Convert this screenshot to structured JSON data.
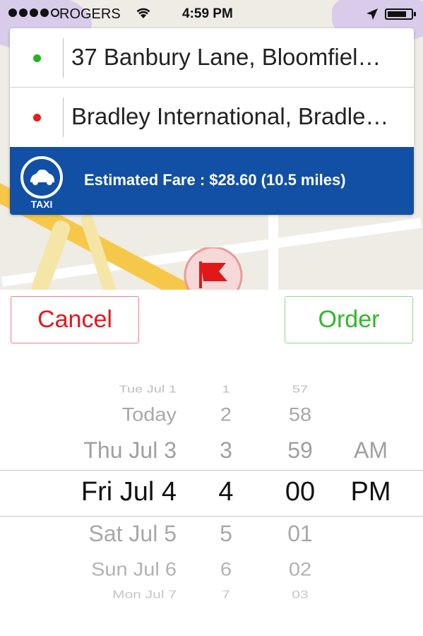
{
  "status_bar": {
    "carrier": "ROGERS",
    "time": "4:59 PM",
    "signal_bars_filled": 4,
    "battery_level": 0.8
  },
  "route": {
    "pickup": {
      "address": "37 Banbury Lane, Bloomfiel…",
      "pin_color": "#22b422"
    },
    "dropoff": {
      "address": "Bradley International, Bradle…",
      "pin_color": "#e81d1d"
    }
  },
  "fare": {
    "logo_label": "TAXI",
    "text": "Estimated Fare : $28.60  (10.5 miles)",
    "bar_color": "#1150a4"
  },
  "actions": {
    "cancel_label": "Cancel",
    "order_label": "Order"
  },
  "picker": {
    "dates": [
      "Tue Jul 1",
      "Today",
      "Thu Jul 3",
      "Fri Jul 4",
      "Sat Jul 5",
      "Sun Jul 6",
      "Mon Jul 7"
    ],
    "hours": [
      "1",
      "2",
      "3",
      "4",
      "5",
      "6",
      "7"
    ],
    "minutes": [
      "57",
      "58",
      "59",
      "00",
      "01",
      "02",
      "03"
    ],
    "ampm": [
      "AM",
      "PM"
    ],
    "selected": {
      "date": "Fri Jul 4",
      "hour": "4",
      "minute": "00",
      "ampm": "PM"
    }
  }
}
